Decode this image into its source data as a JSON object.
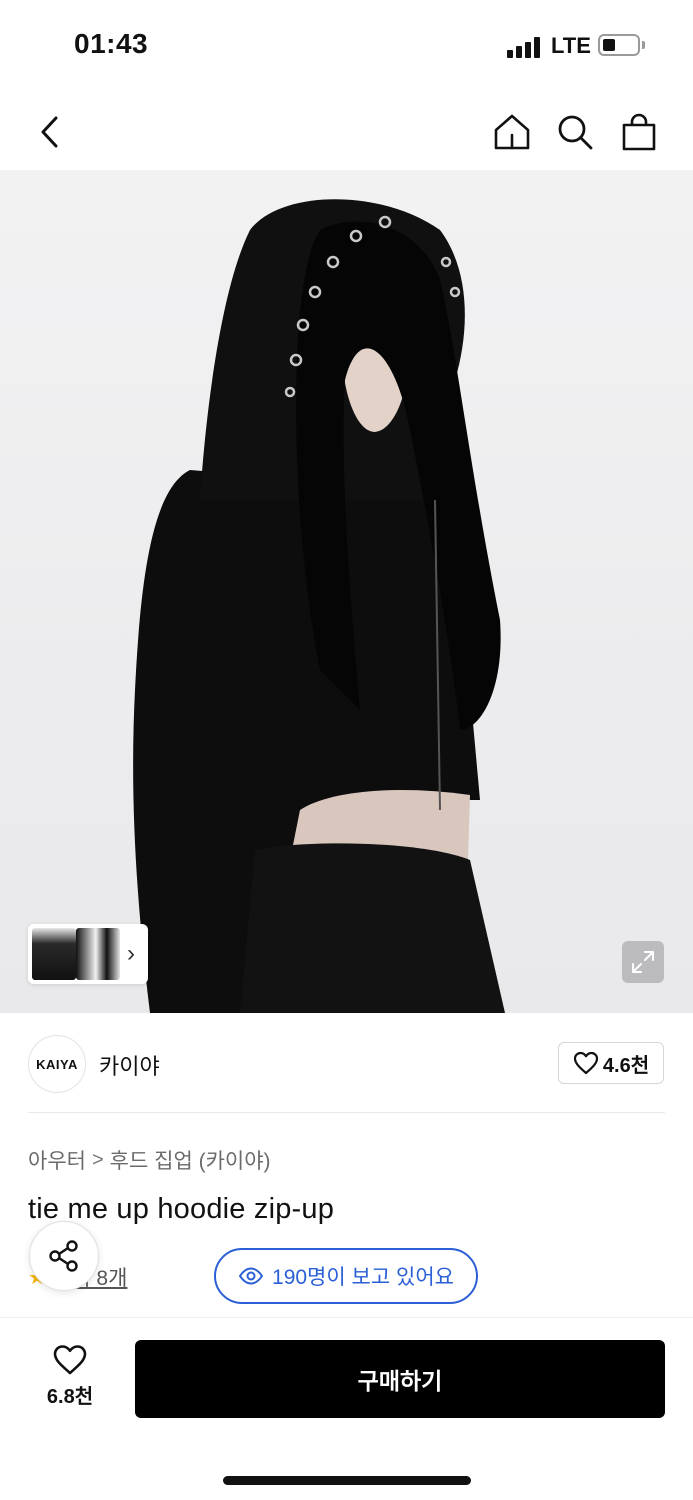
{
  "status": {
    "time": "01:43",
    "network": "LTE"
  },
  "nav": {
    "back_icon": "chevron-left-icon",
    "home_icon": "home-icon",
    "search_icon": "search-icon",
    "cart_icon": "shopping-bag-icon"
  },
  "hero": {
    "thumbnail_count": 2,
    "thumb_arrow": "›"
  },
  "brand": {
    "logo_text": "KAIYA",
    "name": "카이야",
    "likes": "4.6천"
  },
  "breadcrumb": {
    "category": "아우터",
    "separator": ">",
    "subcategory": "후드 집업 (카이야)"
  },
  "product": {
    "title": "tie me up hoodie zip-up"
  },
  "reviews": {
    "label": "후기 8개"
  },
  "viewers": {
    "text": "190명이 보고 있어요"
  },
  "bottom": {
    "wish_count": "6.8천",
    "buy_label": "구매하기"
  },
  "colors": {
    "accent_blue": "#2b5fd6",
    "buy_button": "#000000",
    "star": "#f5b400"
  }
}
